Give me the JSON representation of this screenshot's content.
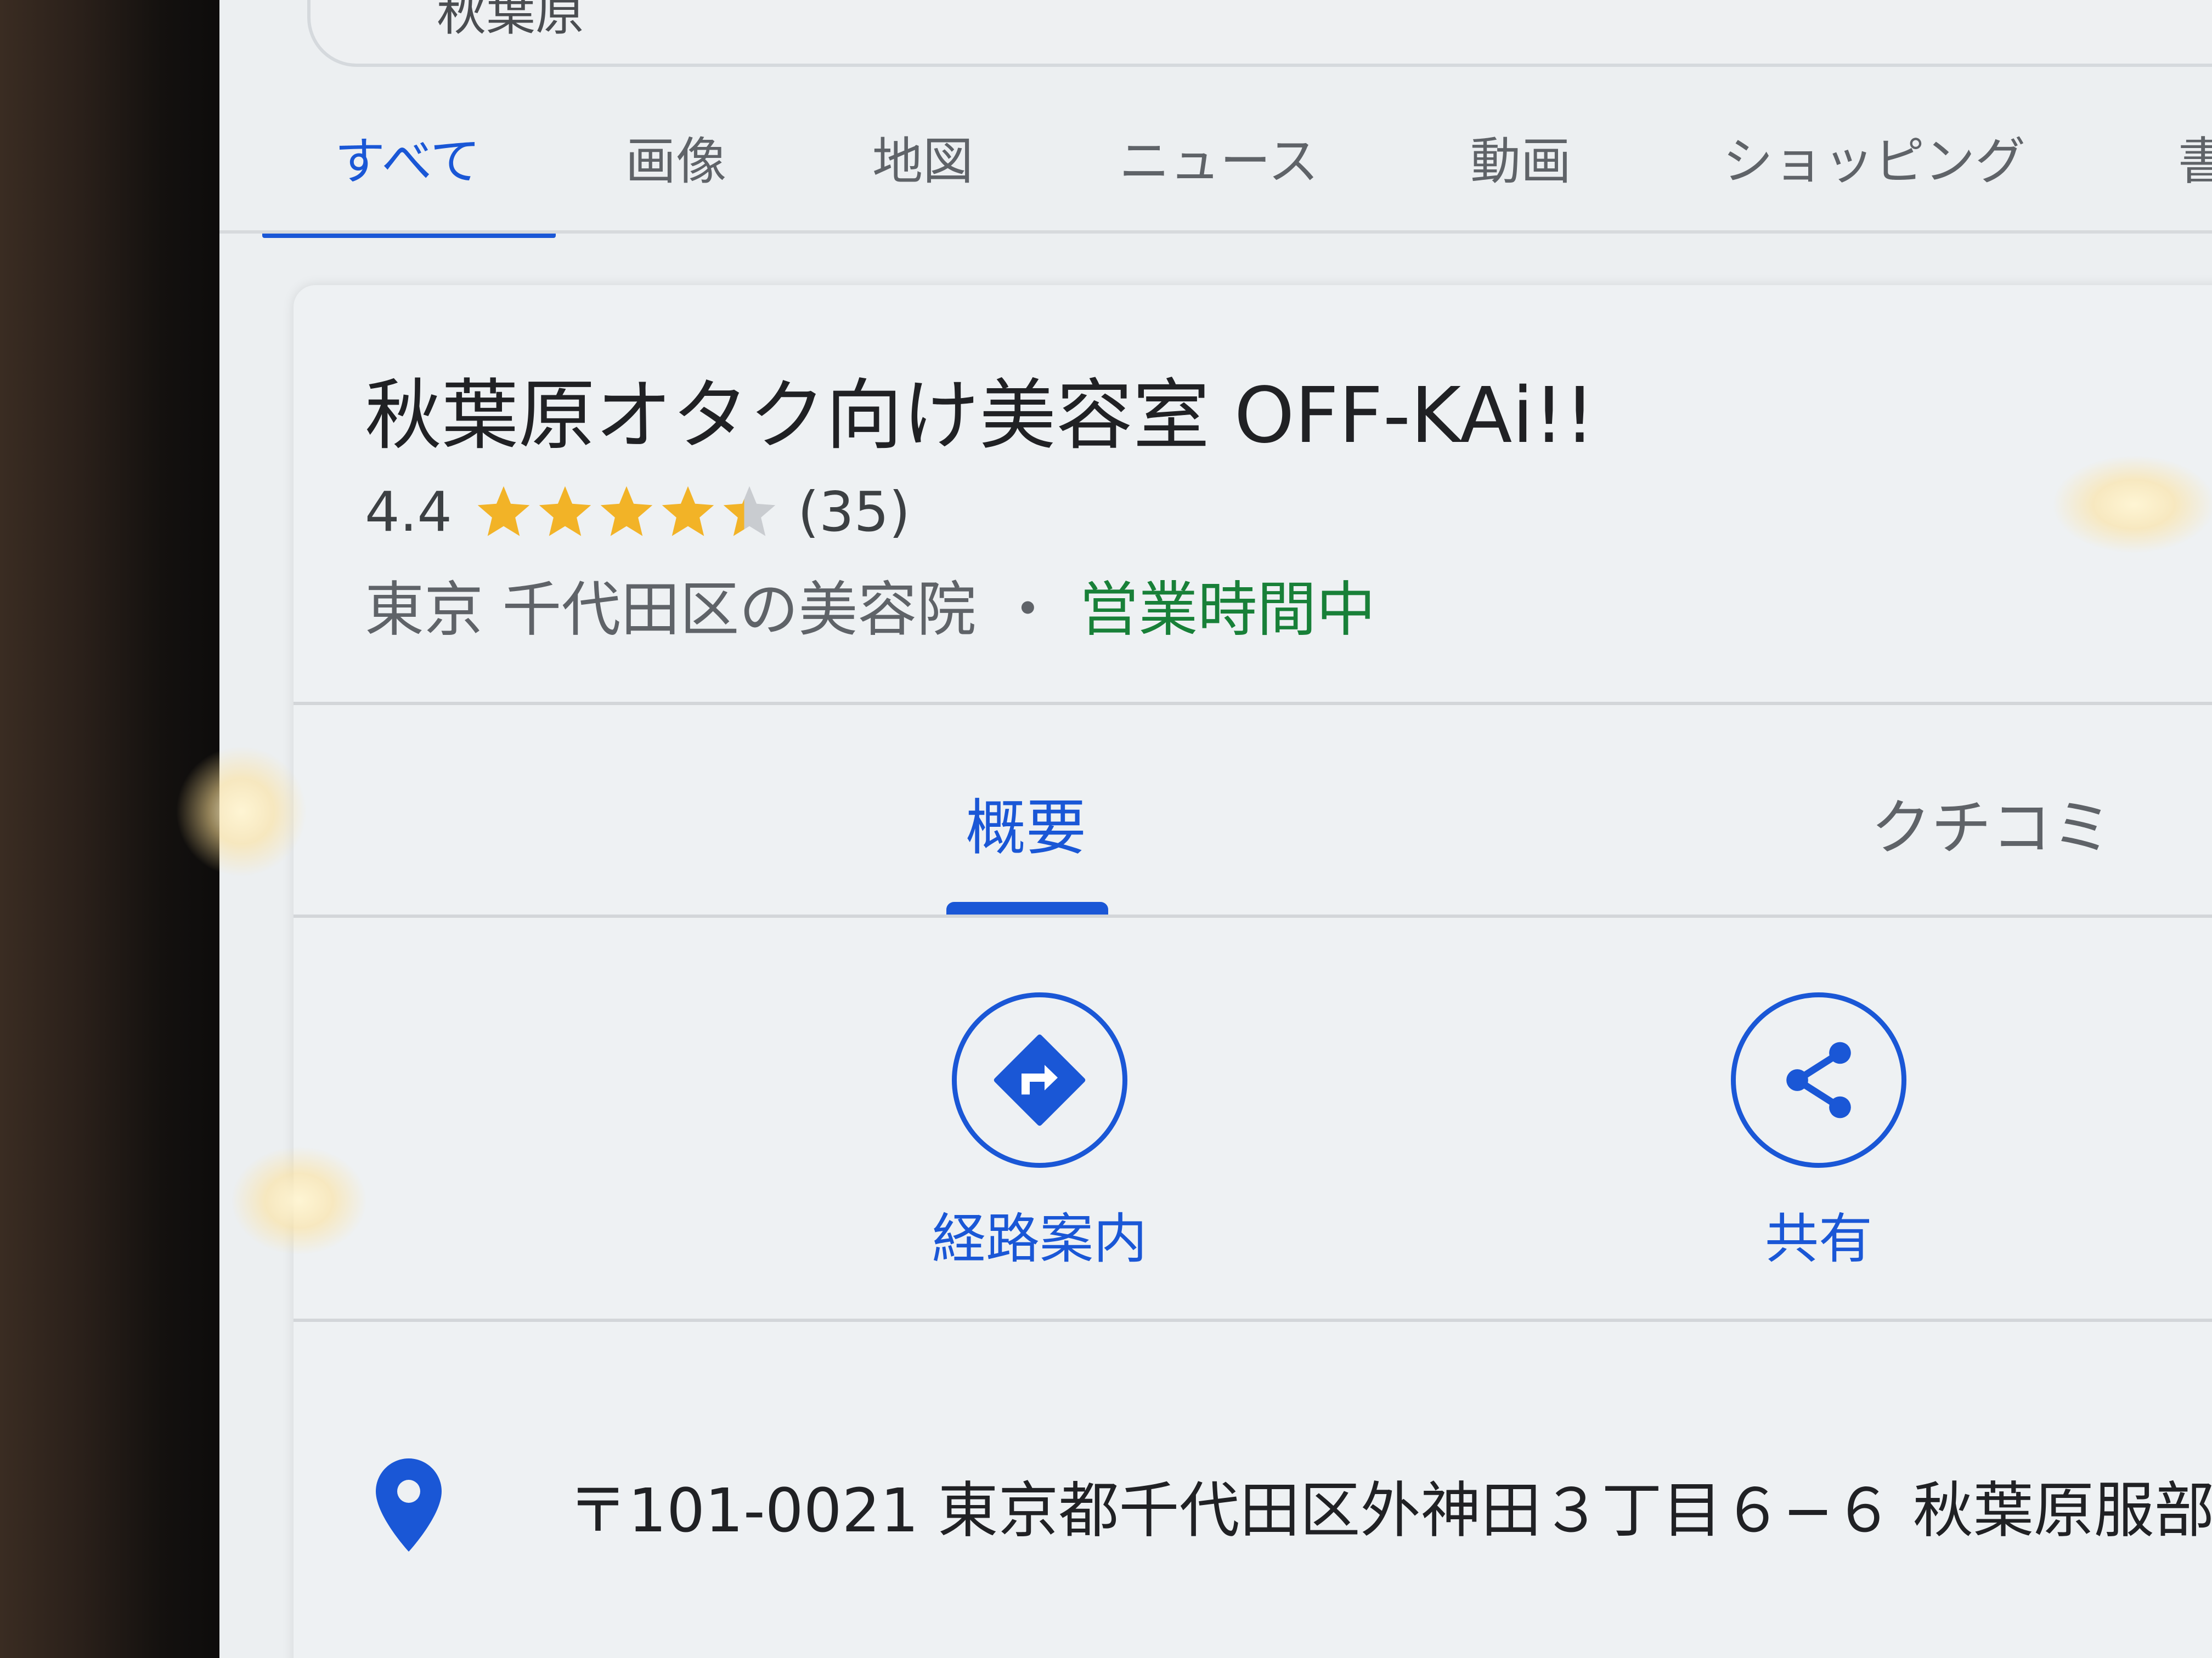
{
  "search": {
    "partial_query": "秋葉原"
  },
  "tabs": [
    {
      "label": "すべて",
      "active": true
    },
    {
      "label": "画像",
      "active": false
    },
    {
      "label": "地図",
      "active": false
    },
    {
      "label": "ニュース",
      "active": false
    },
    {
      "label": "動画",
      "active": false
    },
    {
      "label": "ショッピング",
      "active": false
    },
    {
      "label": "書",
      "active": false
    }
  ],
  "business": {
    "name": "秋葉原オタク向け美容室 OFF-KAi!!",
    "rating": "4.4",
    "rating_value": 4.4,
    "rating_max": 5,
    "review_count": "(35)",
    "category": "東京 千代田区の美容院",
    "separator": "・",
    "status": "営業時間中"
  },
  "subtabs": [
    {
      "label": "概要",
      "active": true
    },
    {
      "label": "クチコミ",
      "active": false
    }
  ],
  "actions": {
    "directions_label": "経路案内",
    "share_label": "共有"
  },
  "address": {
    "text": "〒101-0021 東京都千代田区外神田３丁目６−６ 秋葉原服部"
  },
  "colors": {
    "accent": "#1a57d6",
    "open_status": "#188038",
    "star": "#f2b327"
  }
}
